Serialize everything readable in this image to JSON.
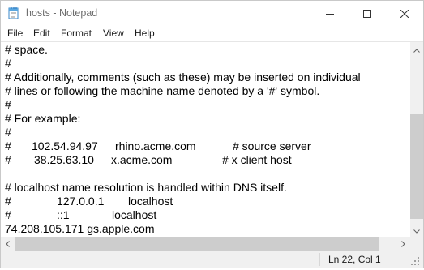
{
  "window": {
    "title": "hosts - Notepad"
  },
  "titlebar": {
    "icons": [
      "notepad-icon",
      "minimize-icon",
      "maximize-icon",
      "close-icon"
    ]
  },
  "menu": {
    "items": [
      {
        "label": "File"
      },
      {
        "label": "Edit"
      },
      {
        "label": "Format"
      },
      {
        "label": "View"
      },
      {
        "label": "Help"
      }
    ]
  },
  "editor": {
    "lines": [
      {
        "segments": [
          "# space."
        ]
      },
      {
        "segments": [
          "#"
        ]
      },
      {
        "segments": [
          "# Additionally, comments (such as these) may be inserted on individual"
        ]
      },
      {
        "segments": [
          "# lines or following the machine name denoted by a '#' symbol."
        ]
      },
      {
        "segments": [
          "#"
        ]
      },
      {
        "segments": [
          "# For example:"
        ]
      },
      {
        "segments": [
          "#"
        ]
      },
      {
        "segments": [
          "#",
          "102.54.94.97",
          "rhino.acme.com",
          "# source server"
        ]
      },
      {
        "segments": [
          "#",
          "38.25.63.10",
          "x.acme.com",
          "# x client host"
        ]
      },
      {
        "segments": [
          ""
        ]
      },
      {
        "segments": [
          "# localhost name resolution is handled within DNS itself."
        ]
      },
      {
        "segments": [
          "#",
          "127.0.0.1",
          "localhost"
        ]
      },
      {
        "segments": [
          "#",
          "::1",
          "localhost"
        ]
      },
      {
        "segments": [
          "74.208.105.171 gs.apple.com"
        ]
      }
    ]
  },
  "statusbar": {
    "position": "Ln 22, Col 1"
  },
  "colors": {
    "text": "#000000",
    "chrome": "#f0f0f0",
    "scroll_thumb": "#cdcdcd"
  }
}
